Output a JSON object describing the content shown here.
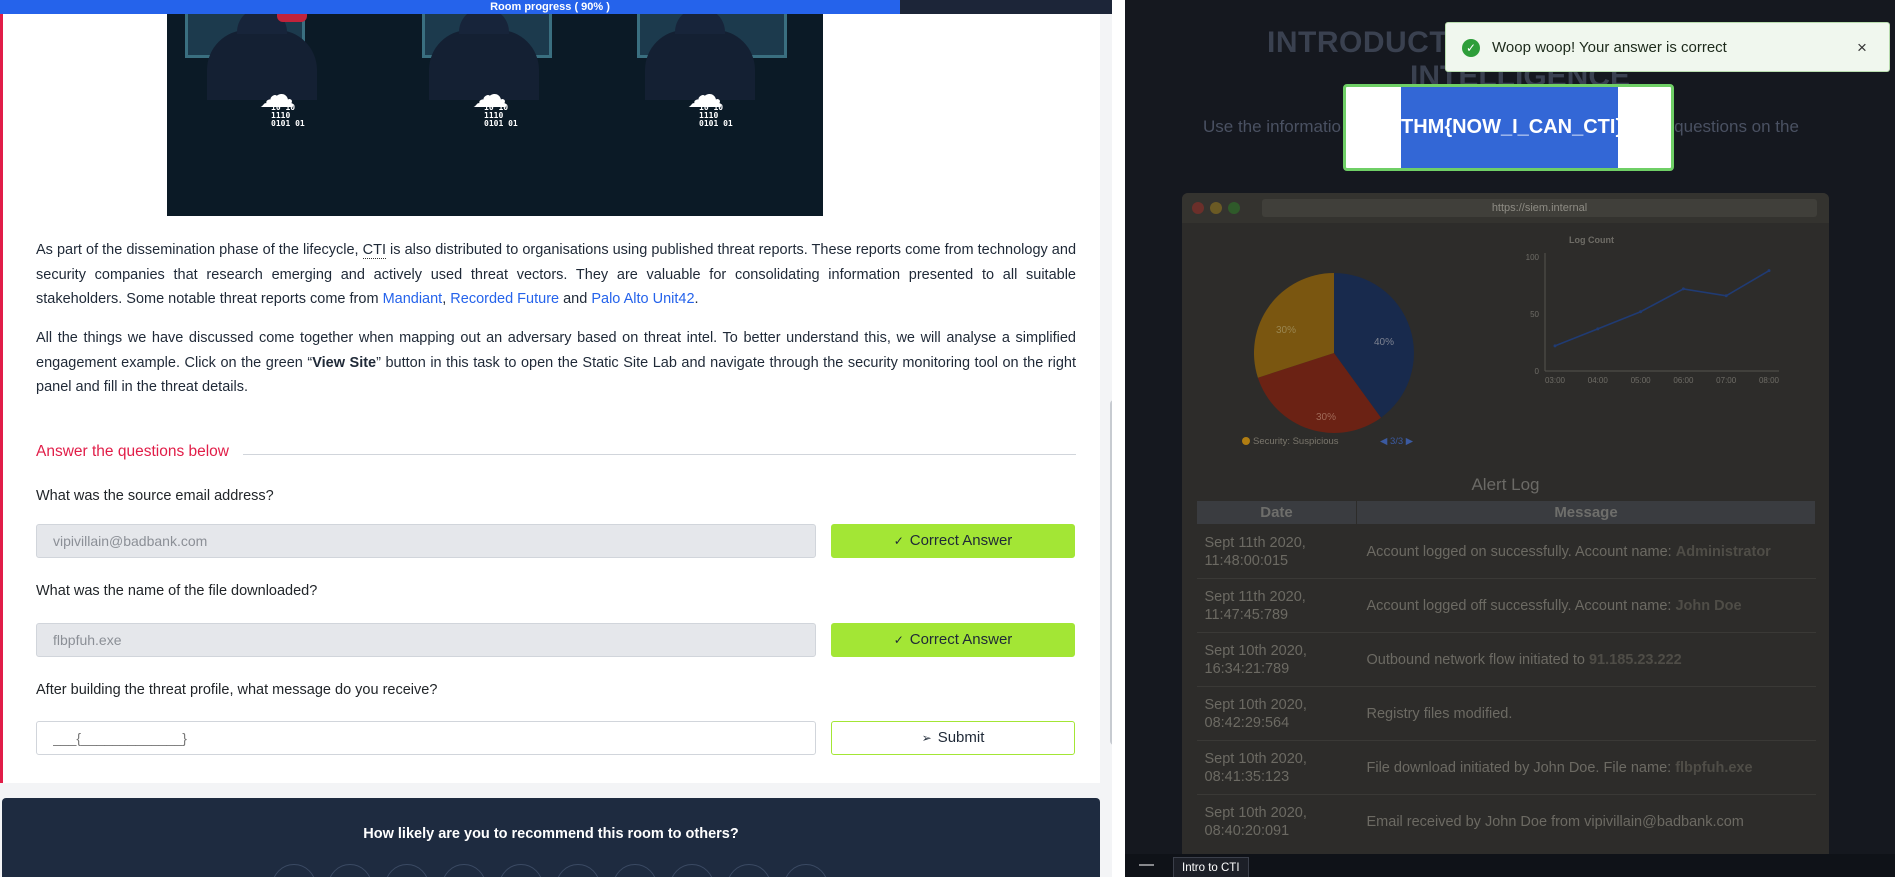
{
  "progress": {
    "label": "Room progress ( 90% )",
    "percent": 90
  },
  "task": {
    "para1": {
      "t1": "As part of the dissemination phase of the lifecycle, ",
      "abbr": "CTI",
      "t2": " is also distributed to organisations using published threat reports. These reports come from technology and security companies that research emerging and actively used threat vectors. They are valuable for consolidating information presented to all suitable stakeholders. Some notable threat reports come from ",
      "link1": "Mandiant",
      "sep1": ", ",
      "link2": "Recorded Future",
      "sep2": " and ",
      "link3": "Palo Alto Unit42",
      "end": "."
    },
    "para2": {
      "t1": "All the things we have discussed come together when mapping out an adversary based on threat intel. To better understand this, we will analyse a simplified engagement example. Click on the green “",
      "bold": "View Site",
      "t2": "” button in this task to open the Static Site Lab and navigate through the security monitoring tool on the right panel and fill in the threat details."
    },
    "answer_header": "Answer the questions below",
    "questions": [
      {
        "text": "What was the source email address?",
        "value": "vipivillain@badbank.com",
        "button": "Correct Answer"
      },
      {
        "text": "What was the name of the file downloaded?",
        "value": "flbpfuh.exe",
        "button": "Correct Answer"
      },
      {
        "text": "After building the threat profile, what message do you receive?",
        "placeholder": "___{_____________}",
        "button": "Submit"
      }
    ],
    "rate_title": "How likely are you to recommend this room to others?"
  },
  "site": {
    "title_part1": "INTRODUCTI",
    "title_part2": "INTELLIGENCE",
    "subtitle_left": "Use the informatio",
    "subtitle_right": "e questions on the",
    "url": "https://siem.internal",
    "pie": {
      "labels_visible": [
        "30%",
        "30%",
        "40%"
      ],
      "legend": "Security: Suspicious",
      "pager": "3/3"
    },
    "alert_log": {
      "title": "Alert Log",
      "columns": [
        "Date",
        "Message"
      ],
      "rows": [
        {
          "date": "Sept 11th 2020, 11:48:00:015",
          "msg": "Account logged on successfully. Account name: ",
          "bold": "Administrator"
        },
        {
          "date": "Sept 11th 2020, 11:47:45:789",
          "msg": "Account logged off successfully. Account name: ",
          "bold": "John Doe"
        },
        {
          "date": "Sept 10th 2020, 16:34:21:789",
          "msg": "Outbound network flow initiated to ",
          "bold": "91.185.23.222"
        },
        {
          "date": "Sept 10th 2020, 08:42:29:564",
          "msg": "Registry files modified.",
          "bold": ""
        },
        {
          "date": "Sept 10th 2020, 08:41:35:123",
          "msg": "File download initiated by John Doe. File name: ",
          "bold": "flbpfuh.exe"
        },
        {
          "date": "Sept 10th 2020, 08:40:20:091",
          "msg": "Email received by John Doe from vipivillain@badbank.com",
          "bold": ""
        }
      ]
    },
    "flag": "THM{NOW_I_CAN_CTI}",
    "toast": "Woop woop! Your answer is correct",
    "taskbar_tab": "Intro to CTI"
  },
  "chart_data": {
    "type": "line",
    "title": "Log Count",
    "x": [
      "03:00",
      "04:00",
      "05:00",
      "06:00",
      "07:00",
      "08:00"
    ],
    "values": [
      22,
      37,
      52,
      72,
      66,
      88
    ],
    "ylim": [
      0,
      100
    ],
    "yticks": [
      0,
      50,
      100
    ]
  },
  "colors": {
    "accent_red": "#e11d48",
    "correct_green": "#a3e635",
    "link_blue": "#2563eb",
    "progress_blue": "#2563eb"
  }
}
